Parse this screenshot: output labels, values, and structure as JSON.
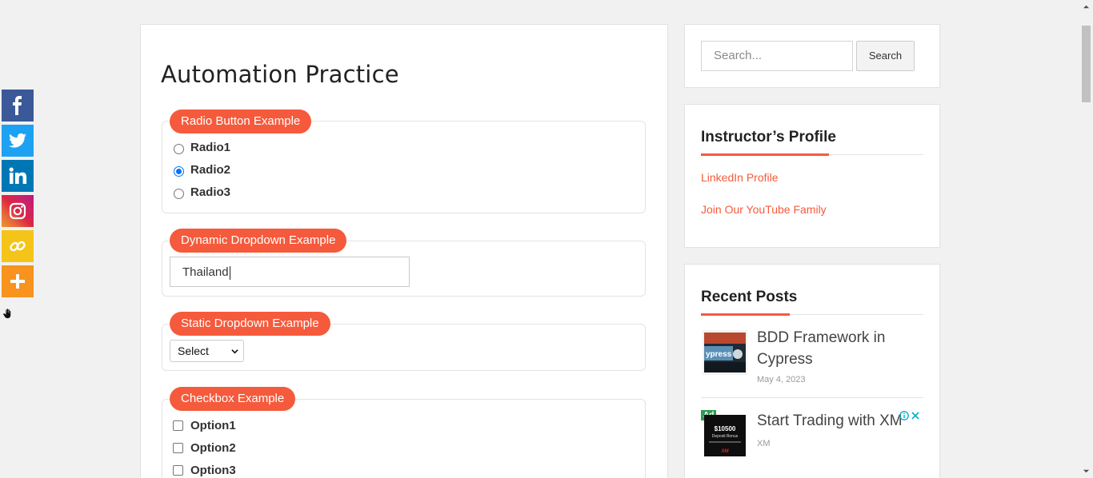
{
  "social": {
    "buttons": [
      {
        "name": "facebook-icon",
        "color": "#3b5998"
      },
      {
        "name": "twitter-icon",
        "color": "#1da1f2"
      },
      {
        "name": "linkedin-icon",
        "color": "#0077b5"
      },
      {
        "name": "instagram-icon",
        "color": "#dc2743"
      },
      {
        "name": "copy-link-icon",
        "color": "#f4c518"
      },
      {
        "name": "more-icon",
        "color": "#f7931e"
      }
    ]
  },
  "page": {
    "title": "Automation Practice"
  },
  "radio": {
    "legend": "Radio Button Example",
    "options": [
      "Radio1",
      "Radio2",
      "Radio3"
    ],
    "selected": "Radio2"
  },
  "dynamic_dropdown": {
    "legend": "Dynamic Dropdown Example",
    "value": "Thailand"
  },
  "static_dropdown": {
    "legend": "Static Dropdown Example",
    "selected": "Select"
  },
  "checkbox": {
    "legend": "Checkbox Example",
    "options": [
      "Option1",
      "Option2",
      "Option3"
    ]
  },
  "sidebar": {
    "search": {
      "placeholder": "Search...",
      "button_label": "Search"
    },
    "instructor": {
      "title": "Instructor’s Profile",
      "links": [
        "LinkedIn Profile",
        "Join Our YouTube Family"
      ]
    },
    "recent_posts": {
      "title": "Recent Posts",
      "posts": [
        {
          "title_line1": "BDD Framework in",
          "title_line2": "Cypress",
          "date": "May 4, 2023"
        }
      ],
      "ad": {
        "badge": "Ad",
        "title": "Start Trading with XM",
        "source": "XM",
        "thumb_amount": "$10500",
        "thumb_text": "Deposit Bonus"
      }
    }
  },
  "colors": {
    "accent": "#f55a3c",
    "link": "#f55a3c",
    "radio_selected": "#0075ff"
  }
}
